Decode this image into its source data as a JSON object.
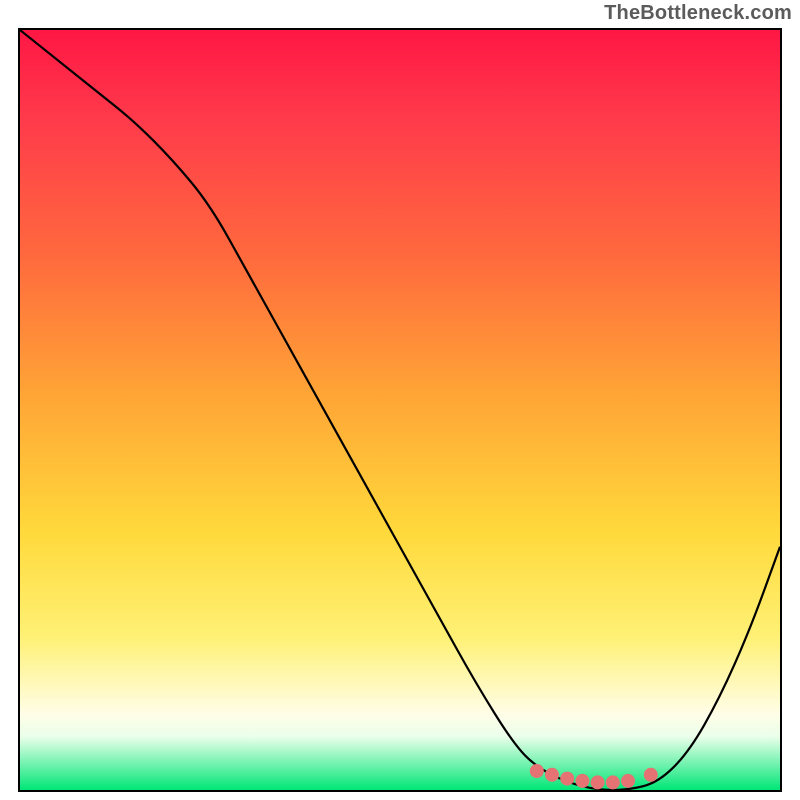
{
  "attribution": "TheBottleneck.com",
  "chart_data": {
    "type": "line",
    "title": "",
    "xlabel": "",
    "ylabel": "",
    "xlim": [
      0,
      100
    ],
    "ylim": [
      0,
      100
    ],
    "series": [
      {
        "name": "bottleneck-curve",
        "x": [
          0,
          5,
          10,
          15,
          20,
          25,
          30,
          35,
          40,
          45,
          50,
          55,
          60,
          65,
          68,
          72,
          76,
          80,
          84,
          88,
          92,
          96,
          100
        ],
        "y": [
          100,
          96,
          92,
          88,
          83,
          77,
          68,
          59,
          50,
          41,
          32,
          23,
          14,
          6,
          3,
          1,
          0,
          0,
          1,
          5,
          12,
          21,
          32
        ]
      }
    ],
    "markers": {
      "name": "selected-range",
      "x": [
        68,
        70,
        72,
        74,
        76,
        78,
        80,
        83
      ],
      "y": [
        2.5,
        2,
        1.5,
        1.2,
        1,
        1,
        1.2,
        2
      ]
    },
    "background": "red-yellow-green vertical gradient"
  }
}
